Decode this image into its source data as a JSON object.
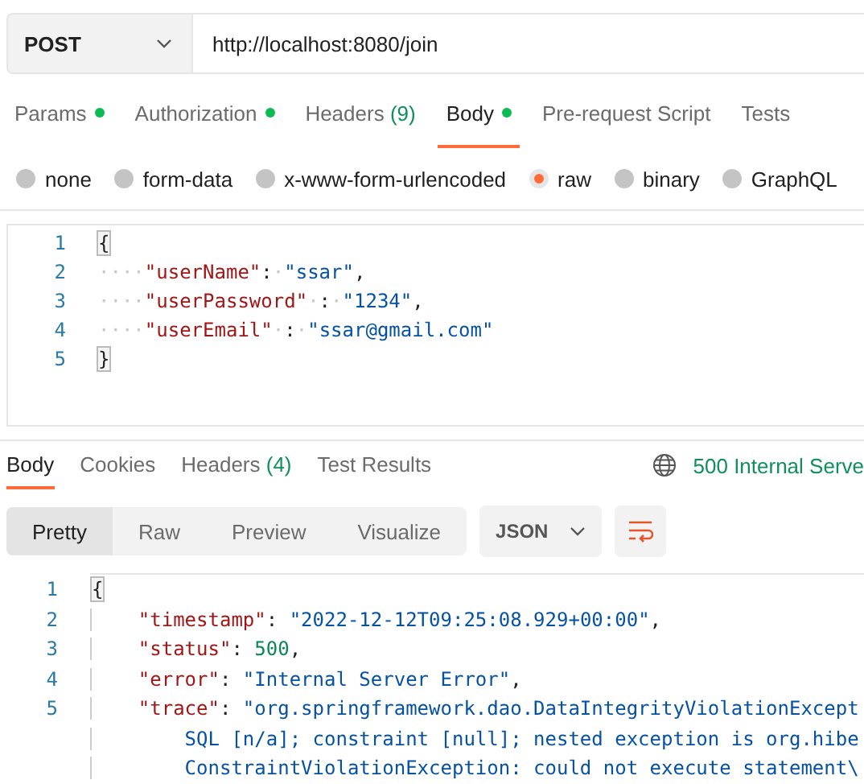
{
  "request": {
    "method": "POST",
    "url": "http://localhost:8080/join"
  },
  "request_tabs": [
    {
      "label": "Params",
      "dot": true,
      "selected": false
    },
    {
      "label": "Authorization",
      "dot": true,
      "selected": false
    },
    {
      "label": "Headers",
      "count": "(9)",
      "dot": false,
      "selected": false
    },
    {
      "label": "Body",
      "dot": true,
      "selected": true
    },
    {
      "label": "Pre-request Script",
      "dot": false,
      "selected": false
    },
    {
      "label": "Tests",
      "dot": false,
      "selected": false
    }
  ],
  "body_types": [
    {
      "label": "none",
      "selected": false
    },
    {
      "label": "form-data",
      "selected": false
    },
    {
      "label": "x-www-form-urlencoded",
      "selected": false
    },
    {
      "label": "raw",
      "selected": true
    },
    {
      "label": "binary",
      "selected": false
    },
    {
      "label": "GraphQL",
      "selected": false
    }
  ],
  "request_body": [
    {
      "number": "1",
      "tokens": [
        {
          "kind": "bracket",
          "text": "{"
        }
      ]
    },
    {
      "number": "2",
      "tokens": [
        {
          "kind": "ws",
          "text": "····"
        },
        {
          "kind": "key",
          "text": "\"userName\""
        },
        {
          "kind": "punct",
          "text": ":"
        },
        {
          "kind": "ws",
          "text": "·"
        },
        {
          "kind": "str",
          "text": "\"ssar\""
        },
        {
          "kind": "punct",
          "text": ","
        }
      ]
    },
    {
      "number": "3",
      "tokens": [
        {
          "kind": "ws",
          "text": "····"
        },
        {
          "kind": "key",
          "text": "\"userPassword\""
        },
        {
          "kind": "ws",
          "text": "·"
        },
        {
          "kind": "punct",
          "text": ":"
        },
        {
          "kind": "ws",
          "text": "·"
        },
        {
          "kind": "str",
          "text": "\"1234\""
        },
        {
          "kind": "punct",
          "text": ","
        }
      ]
    },
    {
      "number": "4",
      "tokens": [
        {
          "kind": "ws",
          "text": "····"
        },
        {
          "kind": "key",
          "text": "\"userEmail\""
        },
        {
          "kind": "ws",
          "text": "·"
        },
        {
          "kind": "punct",
          "text": ":"
        },
        {
          "kind": "ws",
          "text": "·"
        },
        {
          "kind": "str",
          "text": "\"ssar@gmail.com\""
        }
      ]
    },
    {
      "number": "5",
      "tokens": [
        {
          "kind": "bracket",
          "text": "}"
        }
      ]
    }
  ],
  "response": {
    "tabs": [
      {
        "label": "Body",
        "selected": true
      },
      {
        "label": "Cookies",
        "selected": false
      },
      {
        "label": "Headers",
        "count": "(4)",
        "selected": false
      },
      {
        "label": "Test Results",
        "selected": false
      }
    ],
    "status": "500 Internal Serve",
    "view_modes": [
      {
        "label": "Pretty",
        "selected": true
      },
      {
        "label": "Raw",
        "selected": false
      },
      {
        "label": "Preview",
        "selected": false
      },
      {
        "label": "Visualize",
        "selected": false
      }
    ],
    "format": "JSON",
    "lines": [
      {
        "kind": "brace",
        "number": "1",
        "tokens": [
          {
            "kind": "bracket",
            "text": "{"
          }
        ]
      },
      {
        "kind": "member",
        "number": "2",
        "tokens": [
          {
            "kind": "key",
            "text": "\"timestamp\""
          },
          {
            "kind": "punct",
            "text": ": "
          },
          {
            "kind": "str",
            "text": "\"2022-12-12T09:25:08.929+00:00\""
          },
          {
            "kind": "punct",
            "text": ","
          }
        ]
      },
      {
        "kind": "member",
        "number": "3",
        "tokens": [
          {
            "kind": "key",
            "text": "\"status\""
          },
          {
            "kind": "punct",
            "text": ": "
          },
          {
            "kind": "num",
            "text": "500"
          },
          {
            "kind": "punct",
            "text": ","
          }
        ]
      },
      {
        "kind": "member",
        "number": "4",
        "tokens": [
          {
            "kind": "key",
            "text": "\"error\""
          },
          {
            "kind": "punct",
            "text": ": "
          },
          {
            "kind": "str",
            "text": "\"Internal Server Error\""
          },
          {
            "kind": "punct",
            "text": ","
          }
        ]
      },
      {
        "kind": "member",
        "number": "5",
        "tokens": [
          {
            "kind": "key",
            "text": "\"trace\""
          },
          {
            "kind": "punct",
            "text": ": "
          },
          {
            "kind": "str",
            "text": "\"org.springframework.dao.DataIntegrityViolationExcept"
          }
        ]
      },
      {
        "kind": "continuation",
        "tokens": [
          {
            "kind": "str",
            "text": "SQL [n/a]; constraint [null]; nested exception is org.hibe"
          }
        ]
      },
      {
        "kind": "continuation",
        "tokens": [
          {
            "kind": "str",
            "text": "ConstraintViolationException: could not execute statement\\"
          }
        ]
      }
    ]
  }
}
